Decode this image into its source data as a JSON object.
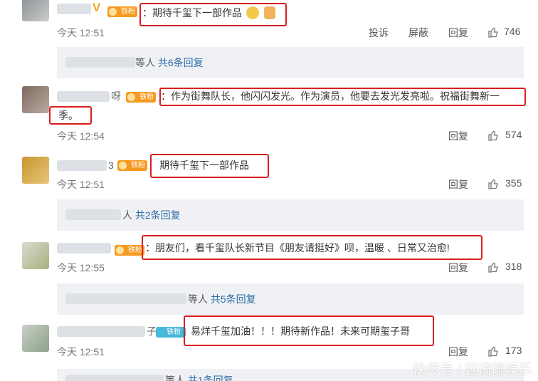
{
  "badges": {
    "tiefen": "铁粉"
  },
  "actions": {
    "reply": "回复",
    "report": "投诉",
    "block": "屏蔽"
  },
  "comments": [
    {
      "text": "：期待千玺下一部作品",
      "time": "今天 12:51",
      "likes": "746"
    },
    {
      "text_line1": "：作为街舞队长，他闪闪发光。作为演员，他要去发光发亮啦。祝福街舞新一",
      "text_line2": "季。",
      "time": "今天 12:54",
      "likes": "574"
    },
    {
      "text": "期待千玺下一部作品",
      "time": "今天 12:51",
      "likes": "355"
    },
    {
      "text": "：朋友们，看千玺队长新节目《朋友请挺好》呗，温暖 、日常又治愈!",
      "time": "今天 12:55",
      "likes": "318"
    },
    {
      "text": "易烊千玺加油！！！期待新作品！未来可期玺子哥",
      "time": "今天 12:51",
      "likes": "173"
    }
  ],
  "reply_bars": [
    {
      "prefix": "等人",
      "count": "共6条回复"
    },
    {
      "prefix": "人",
      "count": "共2条回复"
    },
    {
      "prefix": "等人",
      "count": "共5条回复"
    },
    {
      "prefix": "等人",
      "count": "共1条回复"
    }
  ],
  "fragments": {
    "name2_tail": "呀",
    "name3_tail": "3",
    "name5_tail": "子"
  },
  "watermark": "快传号 / 延琦聊娱乐",
  "colors": {
    "accent_link": "#2b6da8",
    "highlight_box": "#d71f1f",
    "badge": "#f79a21",
    "reply_bar_bg": "#f0f1f4"
  }
}
